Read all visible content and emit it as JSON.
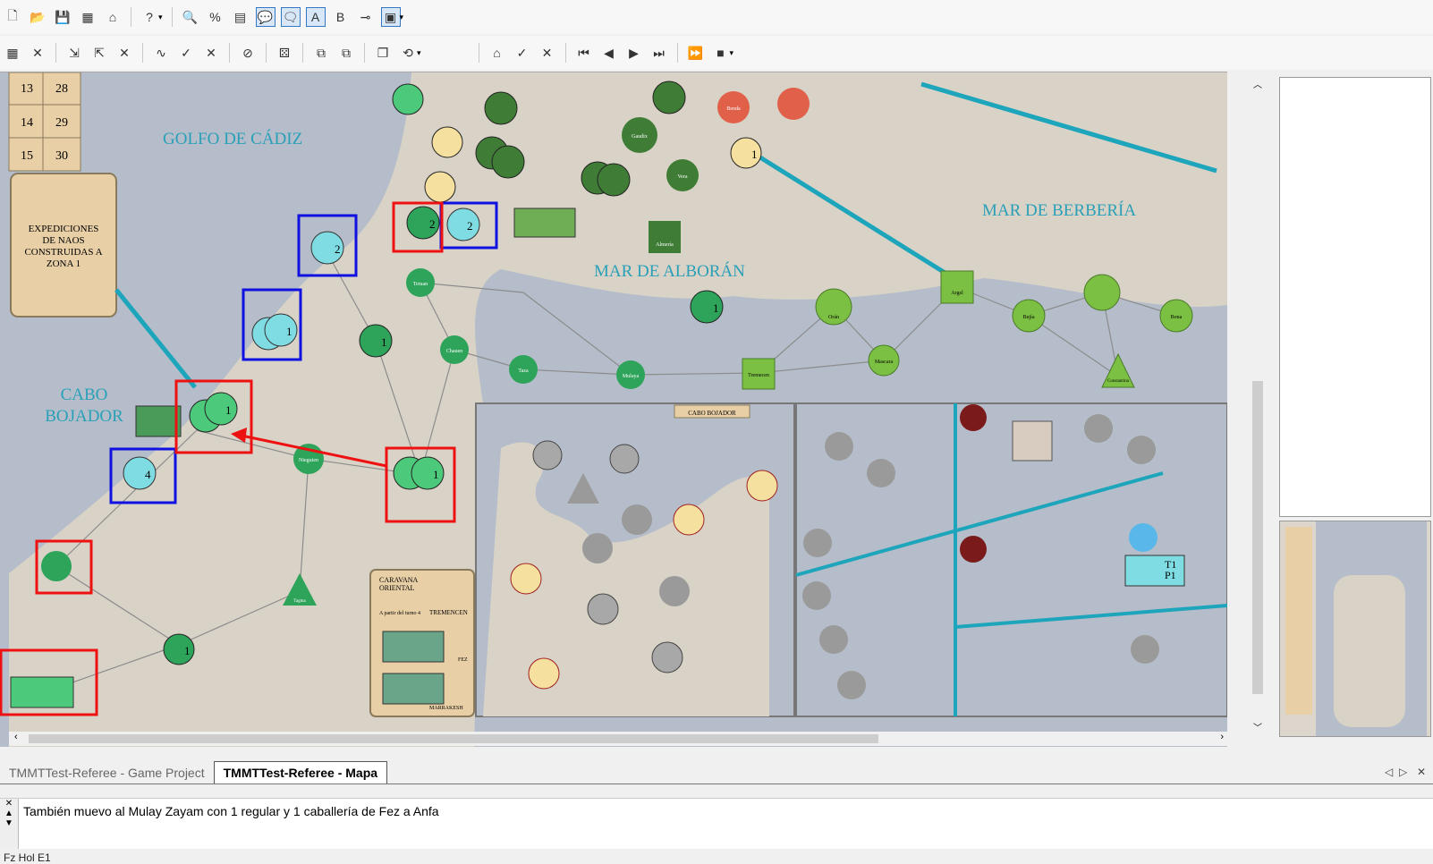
{
  "window": {
    "tabs": [
      {
        "label": "TMMTTest-Referee - Game Project"
      },
      {
        "label": "TMMTTest-Referee - Mapa"
      }
    ],
    "active_tab": 1,
    "status_text": "Fz Hol                 E1"
  },
  "toolbar1_icons": [
    "new-file-icon",
    "open-folder-icon",
    "save-icon",
    "save-as-icon",
    "close-icon",
    "help-icon",
    "zoom-icon",
    "percent-icon",
    "map-tools-icon",
    "chat-bubble-icon",
    "chat-bubble-alt-icon",
    "text-a-icon",
    "text-b-icon",
    "link-icon",
    "highlight-icon"
  ],
  "toolbar2_icons": [
    "stack-icon",
    "delete-stack-icon",
    "move-icon",
    "move-unit-icon",
    "move-delete-icon",
    "route-icon",
    "route-check-icon",
    "route-delete-icon",
    "hide-icon",
    "dice-icon",
    "stack-up-icon",
    "stack-down-icon",
    "copy-icon",
    "undo-icon",
    "lock-icon",
    "lock-check-icon",
    "lock-delete-icon",
    "first-icon",
    "prev-icon",
    "next-icon",
    "last-icon",
    "fast-forward-icon",
    "stop-icon"
  ],
  "map": {
    "region_labels": {
      "golfo": "GOLFO DE CÁDIZ",
      "alboran": "MAR DE ALBORÁN",
      "berberia": "MAR DE BERBERÍA",
      "cabo_bojador": [
        "CABO",
        "BOJADOR"
      ]
    },
    "turn_track": [
      {
        "a": "13",
        "b": "28"
      },
      {
        "a": "14",
        "b": "29"
      },
      {
        "a": "15",
        "b": "30"
      }
    ],
    "expediciones": [
      "EXPEDICIONES",
      "DE NAOS",
      "CONSTRUIDAS A",
      "ZONA 1"
    ],
    "caravana": {
      "title": [
        "CARAVANA",
        "ORIENTAL"
      ],
      "note": "A partir del turno 4",
      "dest": "TREMENCEN",
      "labels": [
        "FEZ",
        "MARRAKESH"
      ]
    },
    "inset_title": "CABO BOJADOR",
    "ship_counter": {
      "t": "T1",
      "p": "P1"
    },
    "nodes": [
      "Tetuan",
      "Chauen",
      "Taza",
      "Mulaya",
      "Tremecen",
      "Mascara",
      "Orán",
      "Argel",
      "Bujía",
      "Bona",
      "Constantina",
      "Nieguien",
      "Tagma",
      "Gaudix",
      "Vera",
      "Almería",
      "Benda"
    ],
    "unit_numbers": [
      "1",
      "2",
      "4",
      "1",
      "2",
      "1",
      "1",
      "1",
      "2",
      "1",
      "1"
    ]
  },
  "chat": {
    "message": "También muevo al Mulay Zayam con 1 regular y 1 caballería de Fez a Anfa"
  }
}
